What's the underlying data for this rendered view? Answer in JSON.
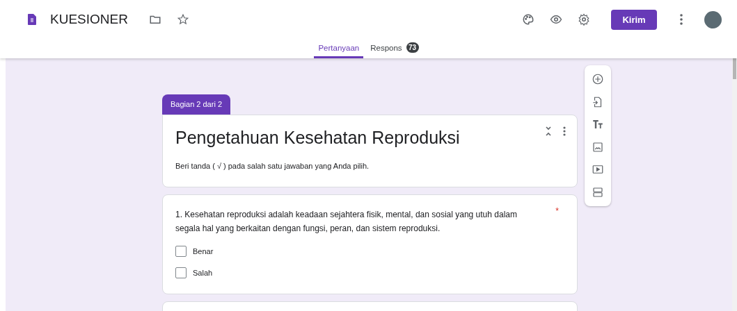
{
  "header": {
    "title": "KUESIONER",
    "send_button": "Kirim"
  },
  "tabs": [
    {
      "label": "Pertanyaan",
      "selected": true
    },
    {
      "label": "Respons",
      "selected": false,
      "badge": "73"
    }
  ],
  "section": {
    "tab": "Bagian 2 dari 2",
    "title": "Pengetahuan Kesehatan Reproduksi",
    "description": "Beri tanda ( √ ) pada salah satu jawaban yang Anda pilih."
  },
  "questions": [
    {
      "text": "1. Kesehatan reproduksi adalah keadaan sejahtera fisik, mental, dan sosial yang utuh dalam segala hal yang berkaitan dengan fungsi, peran, dan sistem reproduksi.",
      "required_mark": "*",
      "options": [
        {
          "label": "Benar",
          "checked": false
        },
        {
          "label": "Salah",
          "checked": false
        }
      ]
    }
  ]
}
